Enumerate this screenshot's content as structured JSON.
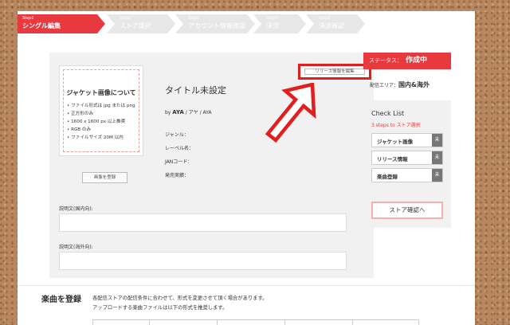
{
  "steps": [
    {
      "no": "Step1",
      "label": "シングル編集"
    },
    {
      "no": "Step2",
      "label": "ストア選択"
    },
    {
      "no": "Step3",
      "label": "アカウント情報確認"
    },
    {
      "no": "Step4",
      "label": "決済"
    },
    {
      "no": "Step5",
      "label": "決済確認"
    }
  ],
  "jacket": {
    "heading": "ジャケット画像について",
    "items": [
      "• ファイル形式は jpg または png",
      "• 正方形のみ",
      "• 1600 x 1600 px 以上推奨",
      "• RGB のみ",
      "• ファイルサイズ 20M 以内"
    ],
    "register_label": "画像を登録"
  },
  "release": {
    "info_button": "リリース情報を編集",
    "title": "タイトル未設定",
    "by_prefix": "by",
    "artist": "AYA",
    "artist_aliases": "/ アヤ / AYA",
    "fields": [
      "ジャンル：",
      "レーベル名：",
      "JANコード：",
      "発売実績："
    ]
  },
  "descriptions": {
    "domestic_label": "説明文(国内向):",
    "overseas_label": "説明文(海外向):"
  },
  "status": {
    "label": "ステータス：",
    "value": "作成中"
  },
  "area": {
    "label": "配信エリア：",
    "value": "国内&海外"
  },
  "checklist": {
    "title": "Check List",
    "subtitle": "3 steps to ストア選択",
    "items": [
      {
        "label": "ジャケット画像",
        "state": "未"
      },
      {
        "label": "リリース情報",
        "state": "未"
      },
      {
        "label": "楽曲登録",
        "state": "未"
      }
    ],
    "store_button": "ストア確認へ"
  },
  "songs": {
    "title": "楽曲を登録",
    "line1": "各配信ストアの配信条件に合わせて、形式を変更させて頂く場合があります。",
    "line2": "アップロードする楽曲ファイルは以下の形式を推奨します。"
  },
  "colors": {
    "accent": "#e8393f",
    "annotation": "#e02020"
  }
}
